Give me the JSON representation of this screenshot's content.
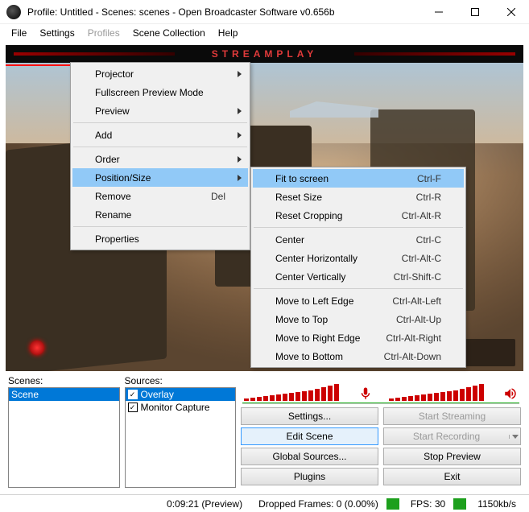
{
  "window": {
    "title": "Profile: Untitled - Scenes: scenes - Open Broadcaster Software v0.656b"
  },
  "menubar": [
    "File",
    "Settings",
    "Profiles",
    "Scene Collection",
    "Help"
  ],
  "menubar_disabled": [
    false,
    false,
    true,
    false,
    false
  ],
  "overlay_brand": "STREAMPLAY",
  "context_menu": {
    "items": [
      {
        "label": "Projector",
        "arrow": true
      },
      {
        "label": "Fullscreen Preview Mode"
      },
      {
        "label": "Preview",
        "arrow": true
      },
      {
        "sep": true
      },
      {
        "label": "Add",
        "arrow": true
      },
      {
        "sep": true
      },
      {
        "label": "Order",
        "arrow": true
      },
      {
        "label": "Position/Size",
        "arrow": true,
        "hover": true
      },
      {
        "label": "Remove",
        "accel": "Del"
      },
      {
        "label": "Rename"
      },
      {
        "sep": true
      },
      {
        "label": "Properties"
      }
    ]
  },
  "submenu": {
    "items": [
      {
        "label": "Fit to screen",
        "accel": "Ctrl-F",
        "hover": true
      },
      {
        "label": "Reset Size",
        "accel": "Ctrl-R"
      },
      {
        "label": "Reset Cropping",
        "accel": "Ctrl-Alt-R"
      },
      {
        "sep": true
      },
      {
        "label": "Center",
        "accel": "Ctrl-C"
      },
      {
        "label": "Center Horizontally",
        "accel": "Ctrl-Alt-C"
      },
      {
        "label": "Center Vertically",
        "accel": "Ctrl-Shift-C"
      },
      {
        "sep": true
      },
      {
        "label": "Move to Left Edge",
        "accel": "Ctrl-Alt-Left"
      },
      {
        "label": "Move to Top",
        "accel": "Ctrl-Alt-Up"
      },
      {
        "label": "Move to Right Edge",
        "accel": "Ctrl-Alt-Right"
      },
      {
        "label": "Move to Bottom",
        "accel": "Ctrl-Alt-Down"
      }
    ]
  },
  "panels": {
    "scenes_label": "Scenes:",
    "sources_label": "Sources:",
    "scenes": [
      {
        "name": "Scene",
        "sel": true
      }
    ],
    "sources": [
      {
        "name": "Overlay",
        "checked": true,
        "sel": true
      },
      {
        "name": "Monitor Capture",
        "checked": true
      }
    ]
  },
  "buttons": {
    "settings": "Settings...",
    "start_streaming": "Start Streaming",
    "edit_scene": "Edit Scene",
    "start_recording": "Start Recording",
    "global_sources": "Global Sources...",
    "stop_preview": "Stop Preview",
    "plugins": "Plugins",
    "exit": "Exit"
  },
  "status": {
    "time": "0:09:21 (Preview)",
    "dropped": "Dropped Frames: 0 (0.00%)",
    "fps": "FPS: 30",
    "bitrate": "1150kb/s"
  },
  "meters": {
    "mic": [
      3,
      4,
      5,
      6,
      7,
      8,
      9,
      10,
      11,
      12,
      13,
      15,
      17,
      19,
      21
    ],
    "spk": [
      3,
      4,
      5,
      6,
      7,
      8,
      9,
      10,
      11,
      12,
      13,
      15,
      17,
      19,
      21
    ]
  }
}
